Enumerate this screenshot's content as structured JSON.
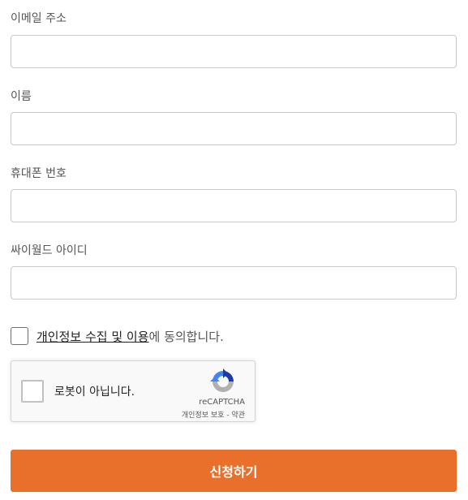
{
  "form": {
    "email": {
      "label": "이메일 주소",
      "value": "",
      "placeholder": ""
    },
    "name": {
      "label": "이름",
      "value": "",
      "placeholder": ""
    },
    "phone": {
      "label": "휴대폰 번호",
      "value": "",
      "placeholder": ""
    },
    "cyworld_id": {
      "label": "싸이월드 아이디",
      "value": "",
      "placeholder": ""
    },
    "agreement": {
      "link_text": "개인정보 수집 및 이용",
      "suffix_text": "에 동의합니다.",
      "checked": false
    },
    "recaptcha": {
      "label": "로봇이 아닙니다.",
      "brand": "reCAPTCHA",
      "privacy_link": "개인정보 보호",
      "separator": " - ",
      "terms_link": "약관",
      "colors": {
        "blue": "#1c3aa9",
        "light_blue": "#4285f4",
        "gray": "#b0b0b0"
      }
    },
    "submit_label": "신청하기"
  },
  "colors": {
    "accent": "#e8702a",
    "input_border": "#c8c8c8",
    "label_text": "#555555"
  }
}
